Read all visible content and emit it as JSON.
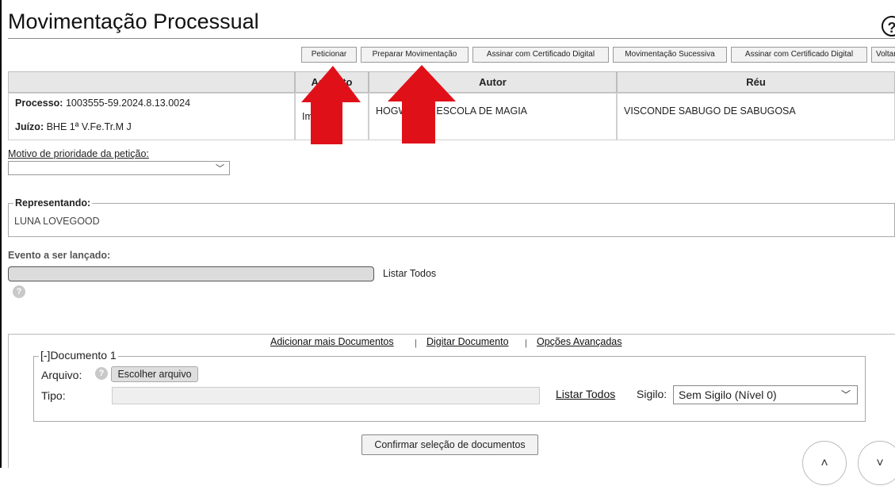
{
  "page": {
    "title": "Movimentação Processual",
    "help_icon": "?"
  },
  "toolbar": [
    {
      "label": "Peticionar"
    },
    {
      "label": "Preparar Movimentação"
    },
    {
      "label": "Assinar com Certificado Digital"
    },
    {
      "label": "Movimentação Sucessiva"
    },
    {
      "label": "Assinar com Certificado Digital"
    },
    {
      "label": "Voltar"
    }
  ],
  "table": {
    "headers": [
      "",
      "Assunto",
      "Autor",
      "Réu"
    ],
    "processo_label": "Processo:",
    "processo_value": "1003555-59.2024.8.13.0024",
    "juizo_label": "Juízo:",
    "juizo_value": "BHE 1ª V.Fe.Tr.M J",
    "assunto": "Im",
    "autor": "HOGWARTS ESCOLA DE MAGIA",
    "reu": "VISCONDE SABUGO DE SABUGOSA"
  },
  "motivo": {
    "label": "Motivo de prioridade da petição:",
    "selected": ""
  },
  "representando": {
    "legend": "Representando:",
    "value": "LUNA LOVEGOOD"
  },
  "evento": {
    "label": "Evento a ser lançado:",
    "value": "",
    "listar_todos": "Listar Todos"
  },
  "documentos": {
    "links": [
      "Adicionar mais Documentos",
      "Digitar Documento",
      "Opções Avançadas"
    ],
    "separator": "|",
    "legend": "[-]Documento 1",
    "arquivo_label": "Arquivo:",
    "upload_button": "Escolher arquivo",
    "tipo_label": "Tipo:",
    "tipo_value": "",
    "listar_todos": "Listar Todos",
    "sigilo_label": "Sigilo:",
    "sigilo_value": "Sem Sigilo (Nível 0)",
    "confirm_button": "Confirmar seleção de documentos"
  },
  "icons": {
    "arrow_color": "#e01019",
    "scroll_up": "˄",
    "scroll_down": "˅",
    "chevron": "﹀"
  }
}
